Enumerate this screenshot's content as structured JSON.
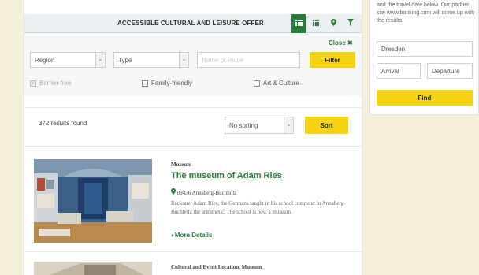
{
  "header": {
    "title": "ACCESSIBLE CULTURAL AND LEISURE OFFER",
    "views": [
      {
        "icon": "list-icon",
        "active": true
      },
      {
        "icon": "grid-icon",
        "active": false
      },
      {
        "icon": "map-pin-icon",
        "active": false
      },
      {
        "icon": "filter-icon",
        "active": false
      }
    ]
  },
  "filters": {
    "close_label": "Close",
    "region": "Region",
    "type": "Type",
    "name_placeholder": "Name or Place",
    "filter_button": "Filter",
    "checkboxes": [
      {
        "label": "Barrier-free",
        "checked": true,
        "disabled": true
      },
      {
        "label": "Family-friendly",
        "checked": false,
        "disabled": false
      },
      {
        "label": "Art & Culture",
        "checked": false,
        "disabled": false
      }
    ]
  },
  "results": {
    "count_text": "372 results found",
    "sorting": "No sorting",
    "sort_button": "Sort"
  },
  "cards": [
    {
      "category": "Museum",
      "title": "The museum of Adam Ries",
      "location": "09456 Annaberg-Buchholz",
      "description": "Reckoner Adam Ries, the Germans taught in his school computer in Annaberg-Buchholz the arithmetic. The school is now a museum.",
      "more": "More Details"
    },
    {
      "category": "Cultural and Event Location, Museum"
    }
  ],
  "sidebar": {
    "intro": "and the travel date below. Our partner site www.booking.com will come up with the results.",
    "destination": "Dresden",
    "arrival": "Arrival",
    "departure": "Departure",
    "find_button": "Find"
  },
  "colors": {
    "accent_green": "#2b7a3e",
    "button_yellow": "#f5d416",
    "page_background": "#f3efdb"
  }
}
